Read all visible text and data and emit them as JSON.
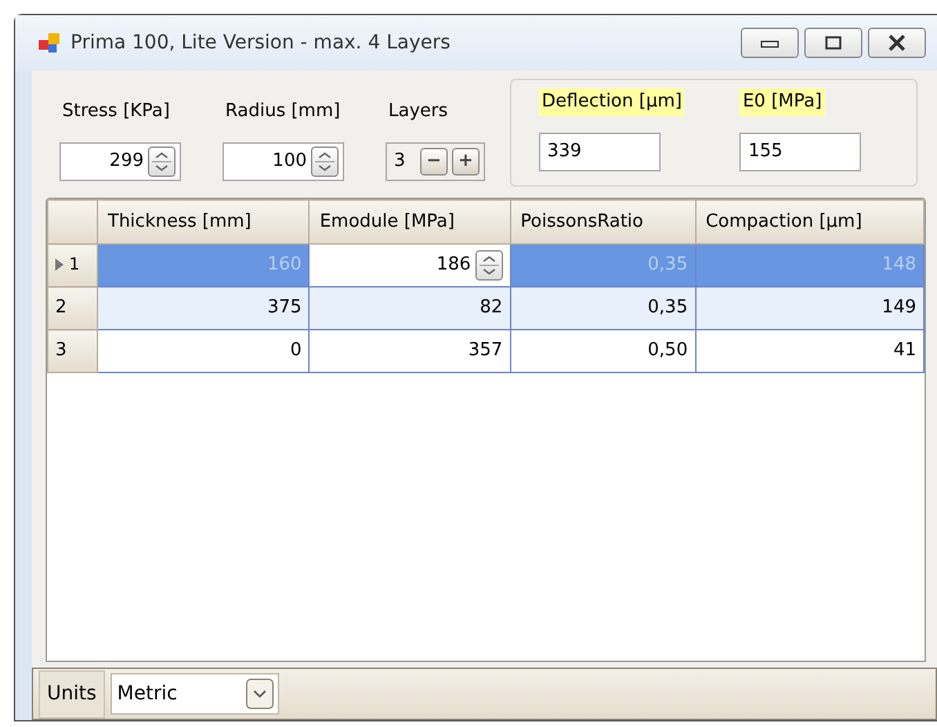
{
  "window": {
    "title": "Prima 100, Lite Version - max. 4 Layers"
  },
  "inputs": [
    {
      "label": "Stress [KPa]",
      "value": "299",
      "kind": "spin"
    },
    {
      "label": "Radius [mm]",
      "value": "100",
      "kind": "spin"
    },
    {
      "label": "Layers",
      "value": "3",
      "kind": "stepper",
      "minus": "−",
      "plus": "+"
    }
  ],
  "results": [
    {
      "label": "Deflection [µm]",
      "value": "339"
    },
    {
      "label": "E0 [MPa]",
      "value": "155"
    }
  ],
  "table": {
    "columns": [
      "Thickness [mm]",
      "Emodule [MPa]",
      "PoissonsRatio",
      "Compaction [µm]"
    ],
    "rows": [
      {
        "header": "1",
        "current": true,
        "selected": true,
        "cells": [
          {
            "text": "160",
            "editing": false
          },
          {
            "text": "186",
            "editing": true
          },
          {
            "text": "0,35",
            "editing": false
          },
          {
            "text": "148",
            "editing": false
          }
        ]
      },
      {
        "header": "2",
        "current": false,
        "selected": false,
        "cells": [
          {
            "text": "375",
            "editing": false
          },
          {
            "text": "82",
            "editing": false
          },
          {
            "text": "0,35",
            "editing": false
          },
          {
            "text": "149",
            "editing": false
          }
        ]
      },
      {
        "header": "3",
        "current": false,
        "selected": false,
        "cells": [
          {
            "text": "0",
            "editing": false
          },
          {
            "text": "357",
            "editing": false
          },
          {
            "text": "0,50",
            "editing": false
          },
          {
            "text": "41",
            "editing": false
          }
        ]
      }
    ]
  },
  "status_bar": {
    "label": "Units",
    "value": "Metric"
  }
}
